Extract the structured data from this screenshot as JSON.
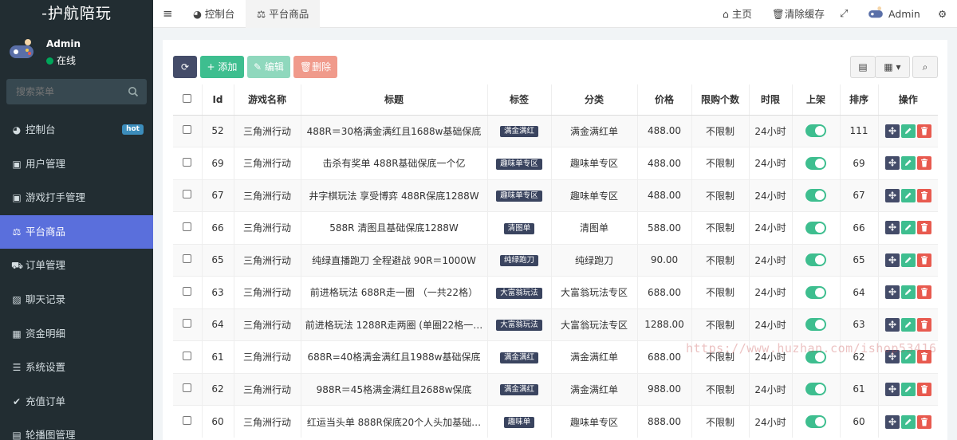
{
  "app": {
    "title": "-护航陪玩"
  },
  "user": {
    "name": "Admin",
    "status": "在线"
  },
  "sidebar": {
    "search_placeholder": "搜索菜单",
    "items": [
      {
        "label": "控制台",
        "icon": "dashboard-icon",
        "badge": "hot"
      },
      {
        "label": "用户管理",
        "icon": "user-card-icon"
      },
      {
        "label": "游戏打手管理",
        "icon": "user-card-icon"
      },
      {
        "label": "平台商品",
        "icon": "scale-icon",
        "active": true
      },
      {
        "label": "订单管理",
        "icon": "cart-icon"
      },
      {
        "label": "聊天记录",
        "icon": "image-icon"
      },
      {
        "label": "资金明细",
        "icon": "calendar-icon"
      },
      {
        "label": "系统设置",
        "icon": "list-icon"
      },
      {
        "label": "充值订单",
        "icon": "check-icon"
      },
      {
        "label": "轮播图管理",
        "icon": "film-icon"
      }
    ]
  },
  "topbar": {
    "tabs": [
      {
        "label": "控制台"
      },
      {
        "label": "平台商品"
      }
    ],
    "home": "主页",
    "clear_cache": "清除缓存",
    "admin": "Admin"
  },
  "toolbar": {
    "add": "添加",
    "edit": "编辑",
    "delete": "删除"
  },
  "table": {
    "headers": [
      "Id",
      "游戏名称",
      "标题",
      "标签",
      "分类",
      "价格",
      "限购个数",
      "时限",
      "上架",
      "排序",
      "操作"
    ],
    "rows": [
      {
        "id": "52",
        "game": "三角洲行动",
        "title": "488R＝30格满金满红且1688w基础保底",
        "tag": "满金满红",
        "category": "满金满红单",
        "price": "488.00",
        "limit": "不限制",
        "time": "24小时",
        "sort": "111"
      },
      {
        "id": "69",
        "game": "三角洲行动",
        "title": "击杀有奖单 488R基础保底一个亿",
        "tag": "趣味单专区",
        "category": "趣味单专区",
        "price": "488.00",
        "limit": "不限制",
        "time": "24小时",
        "sort": "69"
      },
      {
        "id": "67",
        "game": "三角洲行动",
        "title": "井字棋玩法 享受博弈 488R保底1288W",
        "tag": "趣味单专区",
        "category": "趣味单专区",
        "price": "488.00",
        "limit": "不限制",
        "time": "24小时",
        "sort": "67"
      },
      {
        "id": "66",
        "game": "三角洲行动",
        "title": "588R 清图且基础保底1288W",
        "tag": "清图单",
        "category": "清图单",
        "price": "588.00",
        "limit": "不限制",
        "time": "24小时",
        "sort": "66"
      },
      {
        "id": "65",
        "game": "三角洲行动",
        "title": "纯绿直播跑刀 全程避战 90R＝1000W",
        "tag": "纯绿跑刀",
        "category": "纯绿跑刀",
        "price": "90.00",
        "limit": "不限制",
        "time": "24小时",
        "sort": "65"
      },
      {
        "id": "63",
        "game": "三角洲行动",
        "title": "前进格玩法 688R走一圈 （一共22格）",
        "tag": "大富翁玩法",
        "category": "大富翁玩法专区",
        "price": "688.00",
        "limit": "不限制",
        "time": "24小时",
        "sort": "64"
      },
      {
        "id": "64",
        "game": "三角洲行动",
        "title": "前进格玩法 1288R走两圈 (单圈22格一…",
        "tag": "大富翁玩法",
        "category": "大富翁玩法专区",
        "price": "1288.00",
        "limit": "不限制",
        "time": "24小时",
        "sort": "63"
      },
      {
        "id": "61",
        "game": "三角洲行动",
        "title": "688R=40格满金满红且1988w基础保底",
        "tag": "满金满红",
        "category": "满金满红单",
        "price": "688.00",
        "limit": "不限制",
        "time": "24小时",
        "sort": "62"
      },
      {
        "id": "62",
        "game": "三角洲行动",
        "title": "988R＝45格满金满红且2688w保底",
        "tag": "满金满红",
        "category": "满金满红单",
        "price": "988.00",
        "limit": "不限制",
        "time": "24小时",
        "sort": "61"
      },
      {
        "id": "60",
        "game": "三角洲行动",
        "title": "红运当头单 888R保底20个人头加基础…",
        "tag": "趣味单",
        "category": "趣味单专区",
        "price": "888.00",
        "limit": "不限制",
        "time": "24小时",
        "sort": "60"
      }
    ]
  },
  "watermark": "https://www.huzhan.com/ishop53416",
  "colors": {
    "sidebar_bg": "#222d32",
    "active_menu": "#5a6fdc",
    "success": "#3ebe8f",
    "danger": "#e85a4f",
    "primary_dark": "#444c69"
  }
}
